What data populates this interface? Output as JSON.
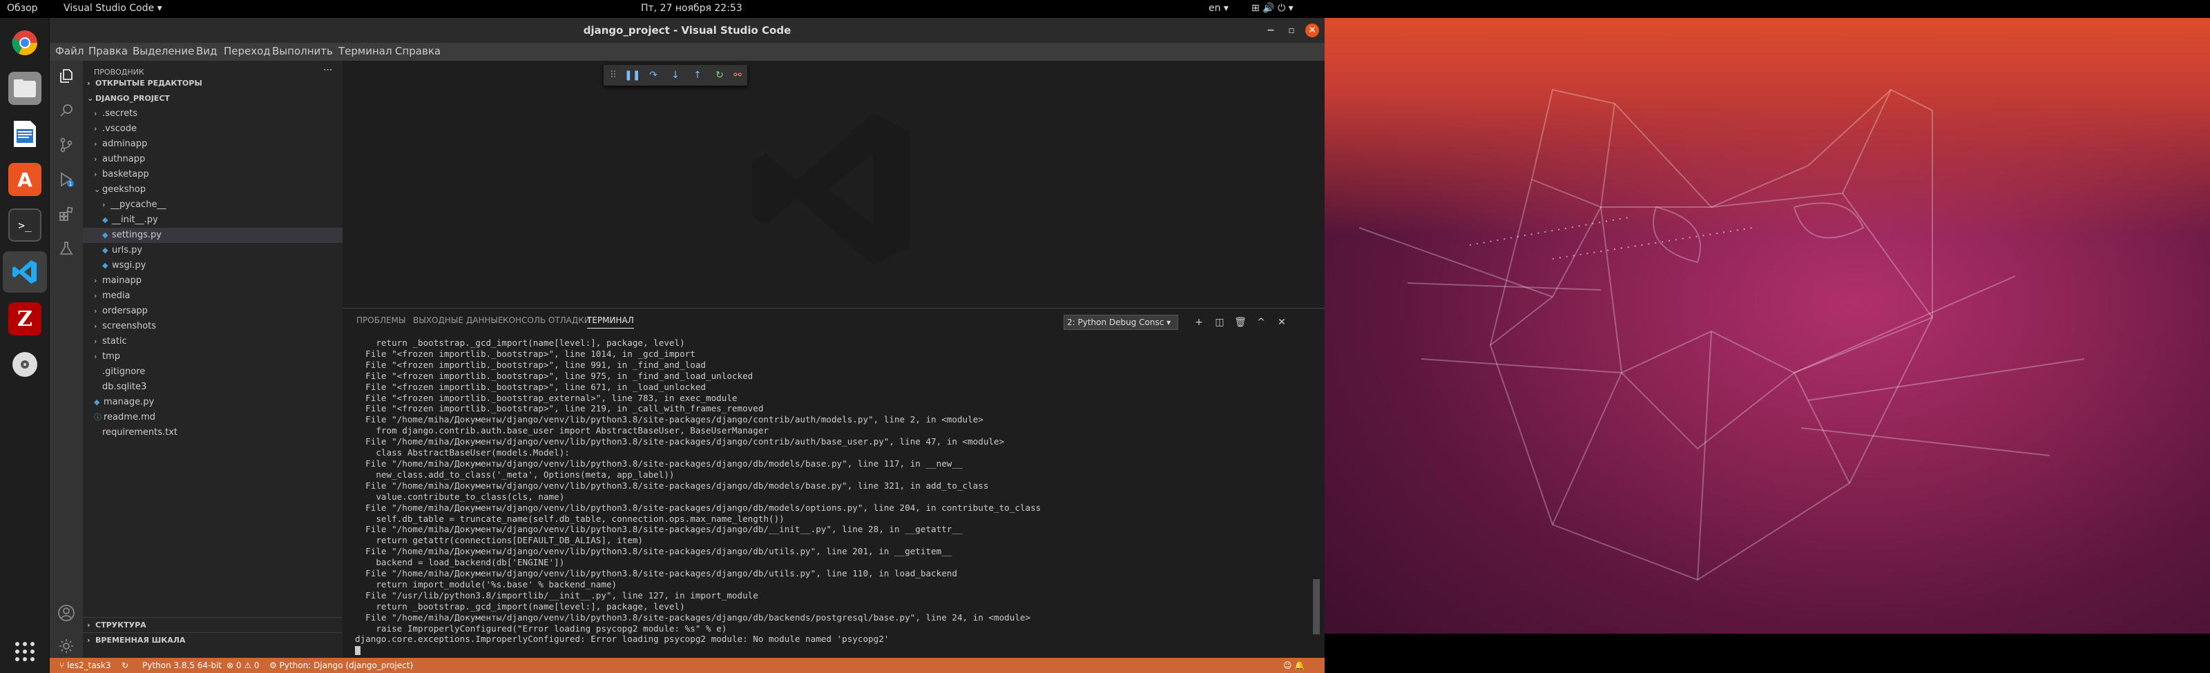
{
  "topbar": {
    "activities": "Обзор",
    "app_menu": "Visual Studio Code ▾",
    "clock": "Пт, 27 ноября  22:53",
    "keyboard": "en ▾",
    "system_icons": "⊞  🔊  ⏻ ▾"
  },
  "window": {
    "title": "django_project - Visual Studio Code",
    "minimize": "−",
    "maximize": "▫",
    "close": "✕"
  },
  "menu": [
    "Файл",
    "Правка",
    "Выделение",
    "Вид",
    "Переход",
    "Выполнить",
    "Терминал",
    "Справка"
  ],
  "sidebar": {
    "header": "ПРОВОДНИК",
    "more": "···",
    "open_editors": "ОТКРЫТЫЕ РЕДАКТОРЫ",
    "project": "DJANGO_PROJECT",
    "items": [
      {
        "label": ".secrets",
        "type": "folder",
        "depth": 1
      },
      {
        "label": ".vscode",
        "type": "folder",
        "depth": 1
      },
      {
        "label": "adminapp",
        "type": "folder",
        "depth": 1
      },
      {
        "label": "authnapp",
        "type": "folder",
        "depth": 1
      },
      {
        "label": "basketapp",
        "type": "folder",
        "depth": 1
      },
      {
        "label": "geekshop",
        "type": "folder-open",
        "depth": 1
      },
      {
        "label": "__pycache__",
        "type": "folder",
        "depth": 2
      },
      {
        "label": "__init__.py",
        "type": "py",
        "depth": 2
      },
      {
        "label": "settings.py",
        "type": "py",
        "depth": 2,
        "selected": true
      },
      {
        "label": "urls.py",
        "type": "py",
        "depth": 2
      },
      {
        "label": "wsgi.py",
        "type": "py",
        "depth": 2
      },
      {
        "label": "mainapp",
        "type": "folder",
        "depth": 1
      },
      {
        "label": "media",
        "type": "folder",
        "depth": 1
      },
      {
        "label": "ordersapp",
        "type": "folder",
        "depth": 1
      },
      {
        "label": "screenshots",
        "type": "folder",
        "depth": 1
      },
      {
        "label": "static",
        "type": "folder",
        "depth": 1
      },
      {
        "label": "tmp",
        "type": "folder",
        "depth": 1
      },
      {
        "label": ".gitignore",
        "type": "file",
        "depth": 1
      },
      {
        "label": "db.sqlite3",
        "type": "file",
        "depth": 1
      },
      {
        "label": "manage.py",
        "type": "py",
        "depth": 1
      },
      {
        "label": "readme.md",
        "type": "info",
        "depth": 1
      },
      {
        "label": "requirements.txt",
        "type": "file",
        "depth": 1
      }
    ],
    "outline": "СТРУКТУРА",
    "timeline": "ВРЕМЕННАЯ ШКАЛА"
  },
  "panel": {
    "tabs": [
      "ПРОБЛЕМЫ",
      "ВЫХОДНЫЕ ДАННЫЕ",
      "КОНСОЛЬ ОТЛАДКИ",
      "ТЕРМИНАЛ"
    ],
    "active_tab": "ТЕРМИНАЛ",
    "terminal_select": "2: Python Debug Consc ▾",
    "buttons": [
      "+",
      "◫",
      "🗑",
      "^",
      "✕"
    ],
    "terminal_lines": [
      "    return _bootstrap._gcd_import(name[level:], package, level)",
      "  File \"<frozen importlib._bootstrap>\", line 1014, in _gcd_import",
      "  File \"<frozen importlib._bootstrap>\", line 991, in _find_and_load",
      "  File \"<frozen importlib._bootstrap>\", line 975, in _find_and_load_unlocked",
      "  File \"<frozen importlib._bootstrap>\", line 671, in _load_unlocked",
      "  File \"<frozen importlib._bootstrap_external>\", line 783, in exec_module",
      "  File \"<frozen importlib._bootstrap>\", line 219, in _call_with_frames_removed",
      "  File \"/home/miha/Документы/django/venv/lib/python3.8/site-packages/django/contrib/auth/models.py\", line 2, in <module>",
      "    from django.contrib.auth.base_user import AbstractBaseUser, BaseUserManager",
      "  File \"/home/miha/Документы/django/venv/lib/python3.8/site-packages/django/contrib/auth/base_user.py\", line 47, in <module>",
      "    class AbstractBaseUser(models.Model):",
      "  File \"/home/miha/Документы/django/venv/lib/python3.8/site-packages/django/db/models/base.py\", line 117, in __new__",
      "    new_class.add_to_class('_meta', Options(meta, app_label))",
      "  File \"/home/miha/Документы/django/venv/lib/python3.8/site-packages/django/db/models/base.py\", line 321, in add_to_class",
      "    value.contribute_to_class(cls, name)",
      "  File \"/home/miha/Документы/django/venv/lib/python3.8/site-packages/django/db/models/options.py\", line 204, in contribute_to_class",
      "    self.db_table = truncate_name(self.db_table, connection.ops.max_name_length())",
      "  File \"/home/miha/Документы/django/venv/lib/python3.8/site-packages/django/db/__init__.py\", line 28, in __getattr__",
      "    return getattr(connections[DEFAULT_DB_ALIAS], item)",
      "  File \"/home/miha/Документы/django/venv/lib/python3.8/site-packages/django/db/utils.py\", line 201, in __getitem__",
      "    backend = load_backend(db['ENGINE'])",
      "  File \"/home/miha/Документы/django/venv/lib/python3.8/site-packages/django/db/utils.py\", line 110, in load_backend",
      "    return import_module('%s.base' % backend_name)",
      "  File \"/usr/lib/python3.8/importlib/__init__.py\", line 127, in import_module",
      "    return _bootstrap._gcd_import(name[level:], package, level)",
      "  File \"/home/miha/Документы/django/venv/lib/python3.8/site-packages/django/db/backends/postgresql/base.py\", line 24, in <module>",
      "    raise ImproperlyConfigured(\"Error loading psycopg2 module: %s\" % e)",
      "django.core.exceptions.ImproperlyConfigured: Error loading psycopg2 module: No module named 'psycopg2'"
    ]
  },
  "statusbar": {
    "branch": "⑂ les2_task3",
    "sync": "↻",
    "python": "Python 3.8.5 64-bit",
    "problems": "⊗ 0 ⚠ 0",
    "debug_config": "⚙ Python: Django (django_project)",
    "right_icons": "☺  🔔"
  },
  "colors": {
    "status_bar": "#cc6633",
    "sidebar": "#252526",
    "editor": "#1e1e1e",
    "activity_bar": "#333333",
    "title_bar": "#2b2b2b"
  }
}
